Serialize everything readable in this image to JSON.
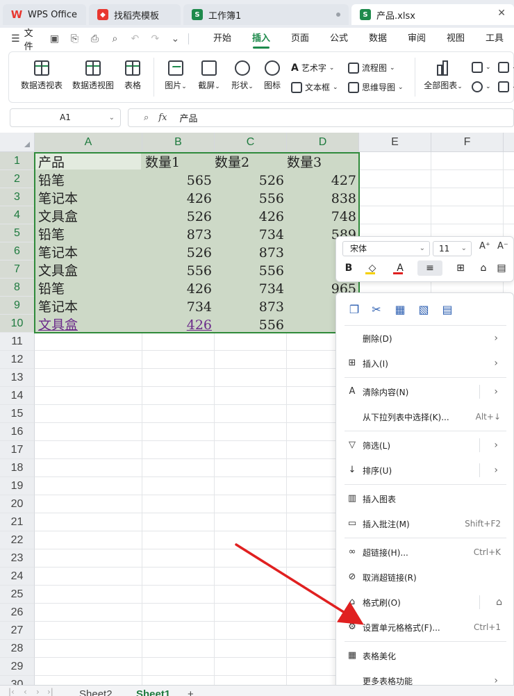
{
  "tabs": [
    {
      "label": "WPS Office"
    },
    {
      "label": "找稻壳模板"
    },
    {
      "label": "工作簿1"
    },
    {
      "label": "产品.xlsx"
    }
  ],
  "menu": {
    "file_label": "文件",
    "tabs": [
      "开始",
      "插入",
      "页面",
      "公式",
      "数据",
      "审阅",
      "视图",
      "工具"
    ],
    "active_tab": "插入"
  },
  "ribbon": {
    "pivot_table": "数据透视表",
    "pivot_view": "数据透视图",
    "table": "表格",
    "picture": "图片",
    "screenshot": "截屏",
    "shape": "形状",
    "icon": "图标",
    "wordart": "艺术字",
    "textbox": "文本框",
    "flowchart": "流程图",
    "mindmap": "思维导图",
    "all_charts": "全部图表"
  },
  "formula": {
    "cell_ref": "A1",
    "fx": "fx",
    "value": "产品"
  },
  "columns": [
    "A",
    "B",
    "C",
    "D",
    "E",
    "F"
  ],
  "rows": [
    "1",
    "2",
    "3",
    "4",
    "5",
    "6",
    "7",
    "8",
    "9",
    "10",
    "11",
    "12",
    "13",
    "14",
    "15",
    "16",
    "17",
    "18",
    "19",
    "20",
    "21",
    "22",
    "23",
    "24",
    "25",
    "26",
    "27",
    "28",
    "29",
    "30"
  ],
  "table": {
    "headers": [
      "产品",
      "数量1",
      "数量2",
      "数量3"
    ],
    "rows": [
      [
        "铅笔",
        "565",
        "526",
        "427"
      ],
      [
        "笔记本",
        "426",
        "556",
        "838"
      ],
      [
        "文具盒",
        "526",
        "426",
        "748"
      ],
      [
        "铅笔",
        "873",
        "734",
        "589"
      ],
      [
        "笔记本",
        "526",
        "873",
        "8"
      ],
      [
        "文具盒",
        "556",
        "556",
        "4"
      ],
      [
        "铅笔",
        "426",
        "734",
        "965"
      ],
      [
        "笔记本",
        "734",
        "873",
        "6"
      ],
      [
        "文具盒",
        "426",
        "556",
        "8"
      ]
    ]
  },
  "mini_toolbar": {
    "font": "宋体",
    "size": "11",
    "bold": "B"
  },
  "context_menu": {
    "items": [
      {
        "label": "删除(D)",
        "shortcut": ""
      },
      {
        "label": "插入(I)",
        "shortcut": ""
      },
      {
        "label": "清除内容(N)",
        "shortcut": ""
      },
      {
        "label": "从下拉列表中选择(K)...",
        "shortcut": "Alt+↓"
      },
      {
        "label": "筛选(L)",
        "shortcut": ""
      },
      {
        "label": "排序(U)",
        "shortcut": ""
      },
      {
        "label": "插入图表",
        "shortcut": ""
      },
      {
        "label": "插入批注(M)",
        "shortcut": "Shift+F2"
      },
      {
        "label": "超链接(H)...",
        "shortcut": "Ctrl+K"
      },
      {
        "label": "取消超链接(R)",
        "shortcut": ""
      },
      {
        "label": "格式刷(O)",
        "shortcut": ""
      },
      {
        "label": "设置单元格格式(F)...",
        "shortcut": "Ctrl+1"
      },
      {
        "label": "表格美化",
        "shortcut": ""
      },
      {
        "label": "更多表格功能",
        "shortcut": ""
      }
    ]
  },
  "sheets": [
    "Sheet2",
    "Sheet1"
  ],
  "active_sheet": "Sheet1",
  "colors": {
    "accent": "#1e8a4c",
    "selection_fill": "#cdd9c7",
    "arrow": "#e02020"
  }
}
